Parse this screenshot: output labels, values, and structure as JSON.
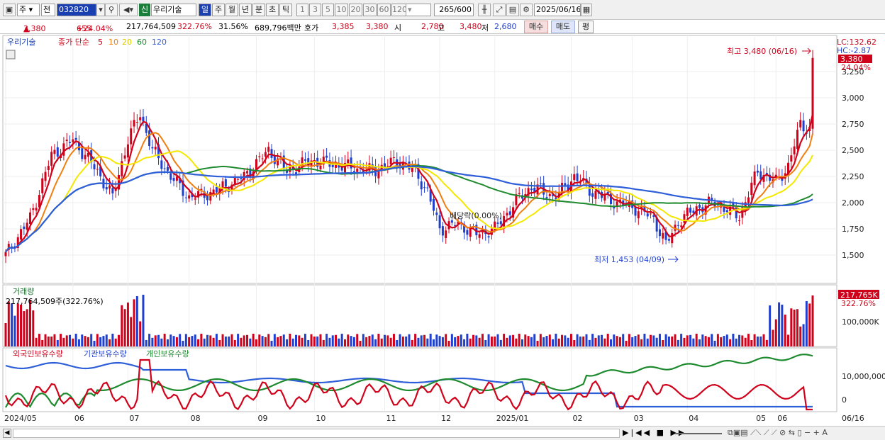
{
  "toolbar": {
    "type_select": "주",
    "prev_label": "전",
    "code": "032820",
    "new_badge": "신",
    "stock_name": "우리기술",
    "period_tabs": [
      "일",
      "주",
      "월",
      "년",
      "분",
      "초",
      "틱"
    ],
    "minute_buttons": [
      "1",
      "3",
      "5",
      "10",
      "20",
      "30",
      "60",
      "120"
    ],
    "count": "265",
    "count_total": "/600",
    "date": "2025/06/16"
  },
  "price_row": {
    "price": "3,380",
    "arrow": "▲",
    "change": "655",
    "pct": "+24.04%",
    "volume": "217,764,509",
    "volume_pct": "322.76%",
    "turnover": "31.56%",
    "amount": "689,796백만",
    "quote_label": "호가",
    "quote_ask": "3,385",
    "quote_bid": "3,380",
    "open_label": "시",
    "open": "2,780",
    "high_label": "고",
    "high": "3,480",
    "low_label": "저",
    "low": "2,680",
    "buy": "매수",
    "sell": "매도",
    "eval": "평"
  },
  "legend": {
    "name": "우리기술",
    "ma_label": "종가 단순",
    "ma_periods": [
      "5",
      "10",
      "20",
      "60",
      "120"
    ]
  },
  "main": {
    "lc": "LC:132.62",
    "hc": "HC:-2.87",
    "last_price": "3,380",
    "last_pct": "24.04%",
    "high_annot": "최고 3,480 (06/16)",
    "low_annot": "최저 1,453 (04/09)",
    "dividend_annot": "배당락(0.00%)",
    "y_labels": [
      "3,250",
      "3,000",
      "2,750",
      "2,500",
      "2,250",
      "2,000",
      "1,750",
      "1,500"
    ]
  },
  "volume": {
    "title": "거래량",
    "value": "217,764,509주(322.76%)",
    "badge": "217,765K",
    "badge_pct": "322.76%",
    "y_label": "100,000K"
  },
  "holdings": {
    "labels": [
      "외국인보유수량",
      "기관보유수량",
      "개인보유수량"
    ],
    "y_labels": [
      "10,000,000",
      "0"
    ]
  },
  "x_labels": [
    "2024/05",
    "06",
    "07",
    "08",
    "09",
    "10",
    "11",
    "12",
    "2025/01",
    "02",
    "03",
    "04",
    "05",
    "06",
    "06/16"
  ],
  "colors": {
    "up": "#d0021b",
    "down": "#1f3fcf",
    "ma5": "#d0021b",
    "ma10": "#f07f10",
    "ma20": "#f5e800",
    "ma60": "#1d8a2e",
    "ma120": "#2f5fd8"
  }
}
